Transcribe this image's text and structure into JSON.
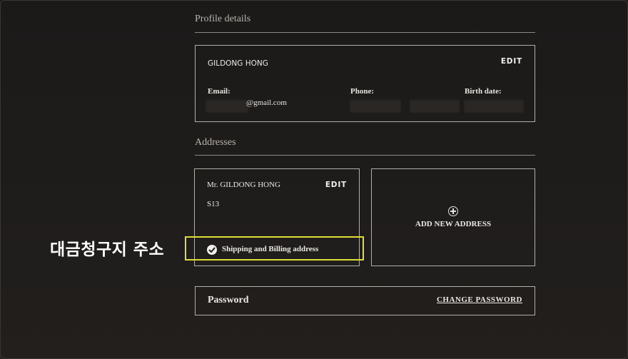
{
  "profile": {
    "section_title": "Profile details",
    "full_name": "GILDONG HONG",
    "edit_label": "EDIT",
    "email_label": "Email:",
    "email_value": "@gmail.com",
    "phone_label": "Phone:",
    "birth_label": "Birth date:"
  },
  "addresses": {
    "section_title": "Addresses",
    "card": {
      "name": "Mr. GILDONG HONG",
      "edit_label": "EDIT",
      "line1": "S13",
      "badge_label": "Shipping and Billing address"
    },
    "add_label": "ADD NEW ADDRESS"
  },
  "password": {
    "label": "Password",
    "change_label": "CHANGE PASSWORD"
  },
  "annotation": {
    "caption": "대금청구지 주소",
    "highlight_color": "#dfdc38"
  },
  "icons": {
    "add": "add-circle-icon",
    "check": "check-circle-icon"
  }
}
